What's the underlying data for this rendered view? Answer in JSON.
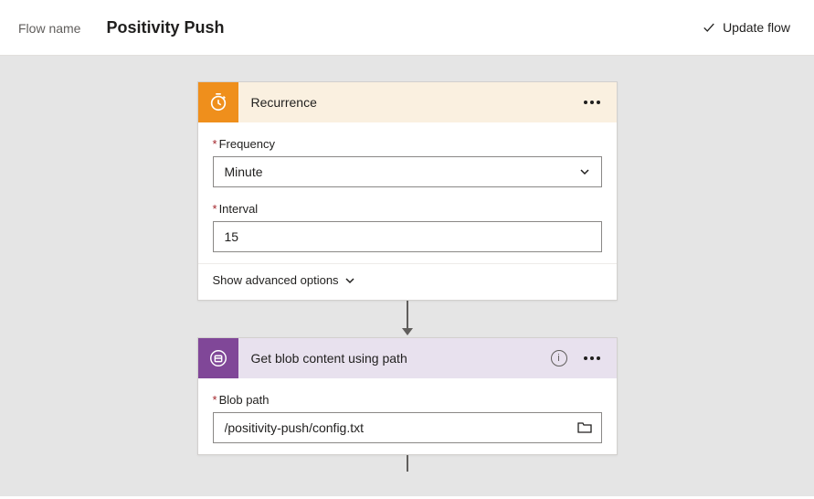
{
  "header": {
    "flow_name_label": "Flow name",
    "flow_title": "Positivity Push",
    "update_flow_label": "Update flow"
  },
  "recurrence_card": {
    "title": "Recurrence",
    "icon_name": "clock-icon",
    "frequency_label": "Frequency",
    "frequency_value": "Minute",
    "interval_label": "Interval",
    "interval_value": "15",
    "advanced_label": "Show advanced options"
  },
  "blob_card": {
    "title": "Get blob content using path",
    "icon_name": "blob-icon",
    "blob_path_label": "Blob path",
    "blob_path_value": "/positivity-push/config.txt"
  },
  "colors": {
    "orange": "#ef8f1c",
    "purple": "#804798",
    "canvas": "#e5e5e5"
  }
}
